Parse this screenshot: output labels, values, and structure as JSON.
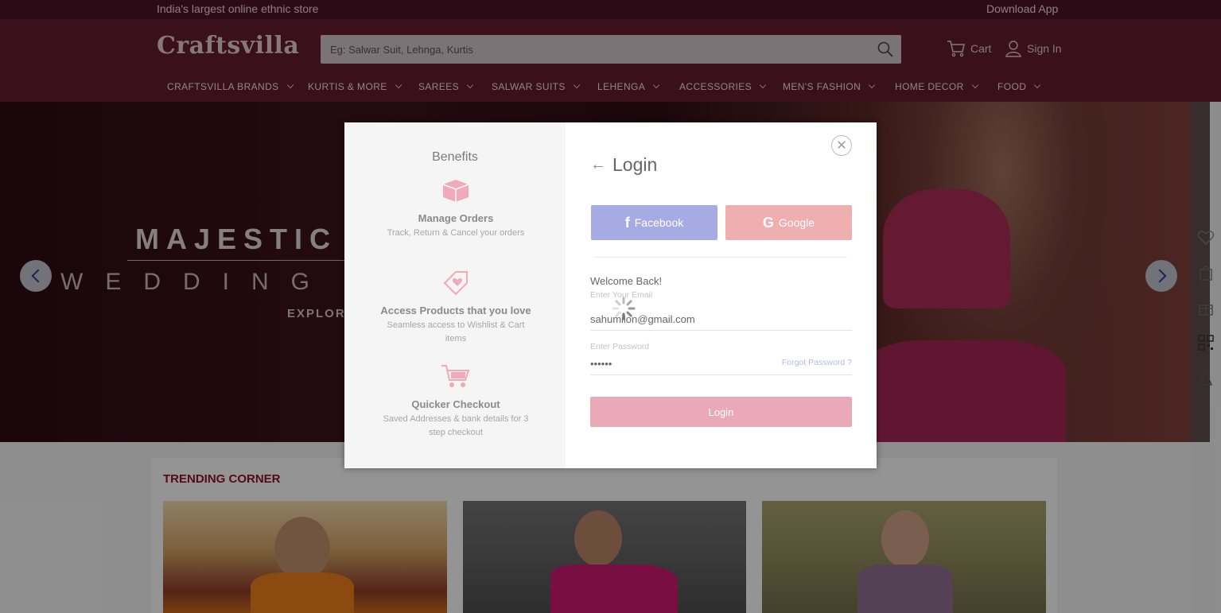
{
  "topbar": {
    "tagline": "India's largest online ethnic store",
    "download": "Download App"
  },
  "header": {
    "logo": "Craftsvilla",
    "search_placeholder": "Eg: Salwar Suit, Lehnga, Kurtis",
    "cart": "Cart",
    "signin": "Sign In"
  },
  "nav": {
    "items": [
      {
        "label": "CRAFTSVILLA BRANDS"
      },
      {
        "label": "KURTIS & MORE"
      },
      {
        "label": "SAREES"
      },
      {
        "label": "SALWAR SUITS"
      },
      {
        "label": "LEHENGA"
      },
      {
        "label": "ACCESSORIES"
      },
      {
        "label": "MEN'S FASHION"
      },
      {
        "label": "HOME DECOR"
      },
      {
        "label": "FOOD"
      }
    ]
  },
  "hero": {
    "line1": "MAJESTIC",
    "line2": "WEDDING L",
    "line3": "EXPLORE"
  },
  "trending": {
    "title": "TRENDING CORNER"
  },
  "modal": {
    "benefits": {
      "title": "Benefits",
      "items": [
        {
          "heading": "Manage Orders",
          "desc": "Track, Return & Cancel your orders",
          "icon": "box-icon"
        },
        {
          "heading": "Access Products that you love",
          "desc": "Seamless access to Wishlist & Cart items",
          "icon": "heart-tag-icon"
        },
        {
          "heading": "Quicker Checkout",
          "desc": "Saved Addresses & bank details for 3 step checkout",
          "icon": "cart-icon"
        }
      ]
    },
    "login": {
      "title": "Login",
      "facebook": "Facebook",
      "google": "Google",
      "welcome": "Welcome Back!",
      "email_label": "Enter Your Email",
      "email_value": "sahumilon@gmail.com",
      "password_label": "Enter Password",
      "password_value": "••••••",
      "forgot": "Forgot Password ?",
      "submit": "Login"
    }
  },
  "colors": {
    "header_bg": "#5e1a30",
    "topbar_bg": "#4a1324",
    "accent": "#8a1030",
    "facebook": "#a6abe3",
    "google": "#efaeb0",
    "login_btn": "#eaa9b8"
  }
}
